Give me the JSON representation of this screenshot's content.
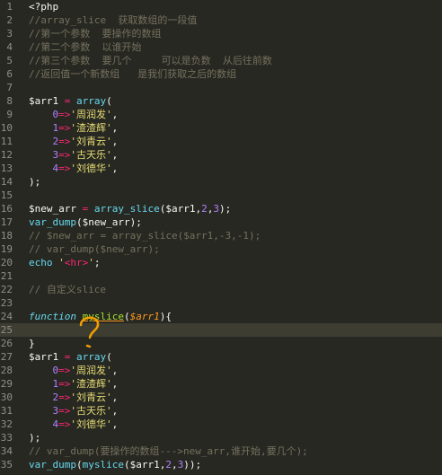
{
  "editor": {
    "lines": [
      {
        "n": "1",
        "tokens": [
          [
            "<?php",
            "p"
          ]
        ]
      },
      {
        "n": "2",
        "tokens": [
          [
            "//array_slice  获取数组的一段值",
            "c"
          ]
        ]
      },
      {
        "n": "3",
        "tokens": [
          [
            "//第一个参数  要操作的数组",
            "c"
          ]
        ]
      },
      {
        "n": "4",
        "tokens": [
          [
            "//第二个参数  以谁开始",
            "c"
          ]
        ]
      },
      {
        "n": "5",
        "tokens": [
          [
            "//第三个参数  要几个     可以是负数  从后往前数",
            "c"
          ]
        ]
      },
      {
        "n": "6",
        "tokens": [
          [
            "//返回值一个新数组   是我们获取之后的数组",
            "c"
          ]
        ]
      },
      {
        "n": "7",
        "tokens": []
      },
      {
        "n": "8",
        "tokens": [
          [
            "$arr1",
            "var"
          ],
          [
            " = ",
            "op"
          ],
          [
            "array",
            "fn"
          ],
          [
            "(",
            "p"
          ]
        ]
      },
      {
        "n": "9",
        "tokens": [
          [
            "    ",
            "p"
          ],
          [
            "0",
            "n"
          ],
          [
            "=>",
            "op"
          ],
          [
            "'周润发'",
            "s"
          ],
          [
            ",",
            "p"
          ]
        ]
      },
      {
        "n": "10",
        "tokens": [
          [
            "    ",
            "p"
          ],
          [
            "1",
            "n"
          ],
          [
            "=>",
            "op"
          ],
          [
            "'渣渣辉'",
            "s"
          ],
          [
            ",",
            "p"
          ]
        ]
      },
      {
        "n": "11",
        "tokens": [
          [
            "    ",
            "p"
          ],
          [
            "2",
            "n"
          ],
          [
            "=>",
            "op"
          ],
          [
            "'刘青云'",
            "s"
          ],
          [
            ",",
            "p"
          ]
        ]
      },
      {
        "n": "12",
        "tokens": [
          [
            "    ",
            "p"
          ],
          [
            "3",
            "n"
          ],
          [
            "=>",
            "op"
          ],
          [
            "'古天乐'",
            "s"
          ],
          [
            ",",
            "p"
          ]
        ]
      },
      {
        "n": "13",
        "tokens": [
          [
            "    ",
            "p"
          ],
          [
            "4",
            "n"
          ],
          [
            "=>",
            "op"
          ],
          [
            "'刘德华'",
            "s"
          ],
          [
            ",",
            "p"
          ]
        ]
      },
      {
        "n": "14",
        "tokens": [
          [
            ");",
            "p"
          ]
        ]
      },
      {
        "n": "15",
        "tokens": []
      },
      {
        "n": "16",
        "tokens": [
          [
            "$new_arr",
            "var"
          ],
          [
            " = ",
            "op"
          ],
          [
            "array_slice",
            "fn"
          ],
          [
            "($arr1,",
            "p"
          ],
          [
            "2",
            "n"
          ],
          [
            ",",
            "p"
          ],
          [
            "3",
            "n"
          ],
          [
            ");",
            "p"
          ]
        ]
      },
      {
        "n": "17",
        "tokens": [
          [
            "var_dump",
            "fn"
          ],
          [
            "($new_arr);",
            "p"
          ]
        ]
      },
      {
        "n": "18",
        "tokens": [
          [
            "// $new_arr = array_slice($arr1,-3,-1);",
            "c"
          ]
        ]
      },
      {
        "n": "19",
        "tokens": [
          [
            "// var_dump($new_arr);",
            "c"
          ]
        ]
      },
      {
        "n": "20",
        "tokens": [
          [
            "echo",
            "fn"
          ],
          [
            " ",
            "p"
          ],
          [
            "'",
            "s"
          ],
          [
            "<hr>",
            "tag"
          ],
          [
            "'",
            "s"
          ],
          [
            ";",
            "p"
          ]
        ]
      },
      {
        "n": "21",
        "tokens": []
      },
      {
        "n": "22",
        "tokens": [
          [
            "// 自定义slice",
            "c"
          ]
        ]
      },
      {
        "n": "23",
        "tokens": []
      },
      {
        "n": "24",
        "tokens": [
          [
            "function",
            "kw"
          ],
          [
            " ",
            "p"
          ],
          [
            "myslice",
            "fname"
          ],
          [
            "(",
            "p"
          ],
          [
            "$arr1",
            "param"
          ],
          [
            "){",
            "p"
          ]
        ]
      },
      {
        "n": "25",
        "tokens": []
      },
      {
        "n": "26",
        "tokens": [
          [
            "}",
            "p"
          ]
        ]
      },
      {
        "n": "27",
        "tokens": [
          [
            "$arr1",
            "var"
          ],
          [
            " = ",
            "op"
          ],
          [
            "array",
            "fn"
          ],
          [
            "(",
            "p"
          ]
        ]
      },
      {
        "n": "28",
        "tokens": [
          [
            "    ",
            "p"
          ],
          [
            "0",
            "n"
          ],
          [
            "=>",
            "op"
          ],
          [
            "'周润发'",
            "s"
          ],
          [
            ",",
            "p"
          ]
        ]
      },
      {
        "n": "29",
        "tokens": [
          [
            "    ",
            "p"
          ],
          [
            "1",
            "n"
          ],
          [
            "=>",
            "op"
          ],
          [
            "'渣渣辉'",
            "s"
          ],
          [
            ",",
            "p"
          ]
        ]
      },
      {
        "n": "30",
        "tokens": [
          [
            "    ",
            "p"
          ],
          [
            "2",
            "n"
          ],
          [
            "=>",
            "op"
          ],
          [
            "'刘青云'",
            "s"
          ],
          [
            ",",
            "p"
          ]
        ]
      },
      {
        "n": "31",
        "tokens": [
          [
            "    ",
            "p"
          ],
          [
            "3",
            "n"
          ],
          [
            "=>",
            "op"
          ],
          [
            "'古天乐'",
            "s"
          ],
          [
            ",",
            "p"
          ]
        ]
      },
      {
        "n": "32",
        "tokens": [
          [
            "    ",
            "p"
          ],
          [
            "4",
            "n"
          ],
          [
            "=>",
            "op"
          ],
          [
            "'刘德华'",
            "s"
          ],
          [
            ",",
            "p"
          ]
        ]
      },
      {
        "n": "33",
        "tokens": [
          [
            ");",
            "p"
          ]
        ]
      },
      {
        "n": "34",
        "tokens": [
          [
            "// var_dump(要操作的数组--->new_arr,谁开始,要几个);",
            "c"
          ]
        ]
      },
      {
        "n": "35",
        "tokens": [
          [
            "var_dump",
            "fn"
          ],
          [
            "(",
            "p"
          ],
          [
            "myslice",
            "fn"
          ],
          [
            "($arr1,",
            "p"
          ],
          [
            "2",
            "n"
          ],
          [
            ",",
            "p"
          ],
          [
            "3",
            "n"
          ],
          [
            "));",
            "p"
          ]
        ]
      }
    ],
    "current_line": "25",
    "annotation_color": "#f5a000"
  }
}
